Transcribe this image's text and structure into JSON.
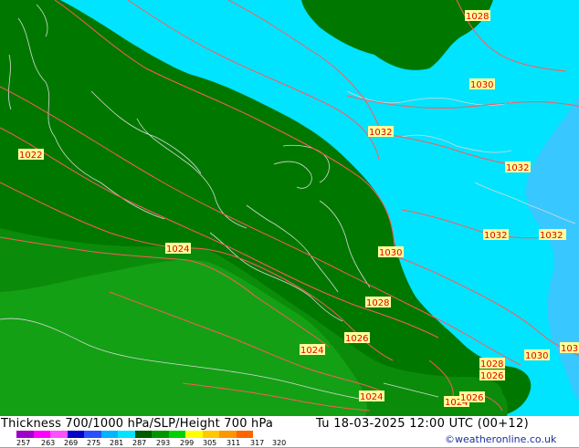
{
  "map": {
    "pressure_labels": [
      "1028",
      "1030",
      "1032",
      "1032",
      "1032",
      "1032",
      "1022",
      "1024",
      "1030",
      "1028",
      "1026",
      "1024",
      "1028",
      "1026",
      "1024",
      "1024",
      "1026",
      "1030",
      "103"
    ],
    "colors": {
      "sea_light": "#00e4ff",
      "sea_deep": "#38c8ff",
      "land_dark": "#007800",
      "land_mid": "#0a8c0a",
      "land_light": "#14a014",
      "isobar": "#ff5a5a",
      "border": "#d8d8d8",
      "label_text": "#e00000",
      "label_bg": "#ffff9a"
    }
  },
  "footer": {
    "title": "Thickness 700/1000 hPa/SLP/Height 700 hPa",
    "valid": "Tu 18-03-2025 12:00 UTC (00+12)",
    "credit": "©weatheronline.co.uk",
    "scale_values": [
      "257",
      "263",
      "269",
      "275",
      "281",
      "287",
      "293",
      "299",
      "305",
      "311",
      "317",
      "320"
    ],
    "scale_colors": [
      "#a000c8",
      "#ff00ff",
      "#ff50ff",
      "#0000c8",
      "#2850ff",
      "#00b4ff",
      "#00e4ff",
      "#005a00",
      "#009600",
      "#00d200",
      "#ffff00",
      "#ffc800",
      "#ff9600",
      "#ff6400"
    ]
  }
}
